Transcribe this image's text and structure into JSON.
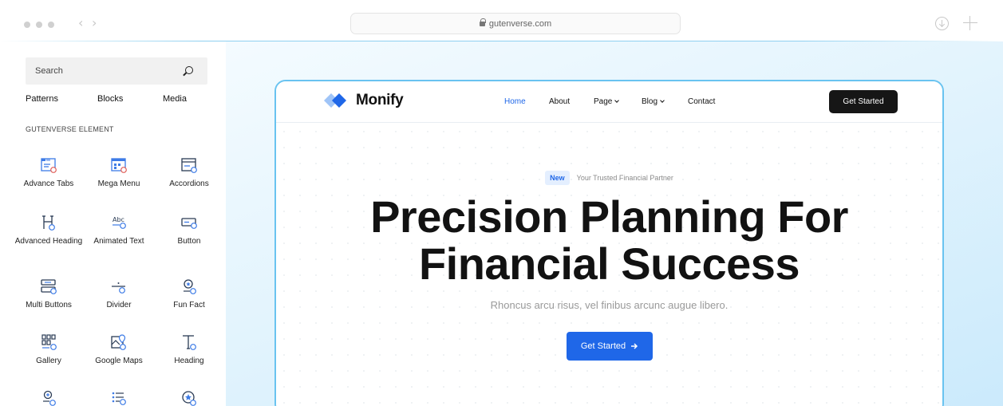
{
  "browser": {
    "url": "gutenverse.com",
    "back_icon": "chevron-left-icon",
    "forward_icon": "chevron-right-icon"
  },
  "sidebar": {
    "search_placeholder": "Search",
    "tabs": [
      "Patterns",
      "Blocks",
      "Media"
    ],
    "section_title": "GUTENVERSE ELEMENT",
    "elements": [
      {
        "label": "Advance Tabs",
        "icon": "tabs-icon"
      },
      {
        "label": "Mega Menu",
        "icon": "mega-menu-icon"
      },
      {
        "label": "Accordions",
        "icon": "accordion-icon"
      },
      {
        "label": "Advanced Heading",
        "icon": "heading-icon"
      },
      {
        "label": "Animated Text",
        "icon": "animated-text-icon"
      },
      {
        "label": "Button",
        "icon": "button-icon"
      },
      {
        "label": "Multi Buttons",
        "icon": "multi-buttons-icon"
      },
      {
        "label": "Divider",
        "icon": "divider-icon"
      },
      {
        "label": "Fun Fact",
        "icon": "fun-fact-icon"
      },
      {
        "label": "Gallery",
        "icon": "gallery-icon"
      },
      {
        "label": "Google Maps",
        "icon": "map-icon"
      },
      {
        "label": "Heading",
        "icon": "heading-icon"
      }
    ]
  },
  "site": {
    "logo_text": "Monify",
    "nav": [
      "Home",
      "About",
      "Page",
      "Blog",
      "Contact"
    ],
    "header_button": "Get Started",
    "badge": "New",
    "tagline": "Your Trusted Financial Partner",
    "headline_line1": "Precision Planning For",
    "headline_line2": "Financial Success",
    "subtext": "Rhoncus arcu risus, vel finibus arcunc augue libero.",
    "hero_button": "Get Started"
  },
  "colors": {
    "accent": "#1f67e8",
    "frame_border": "#69c3f0",
    "dark_button": "#161616",
    "icon_blue": "#3d7be6"
  }
}
